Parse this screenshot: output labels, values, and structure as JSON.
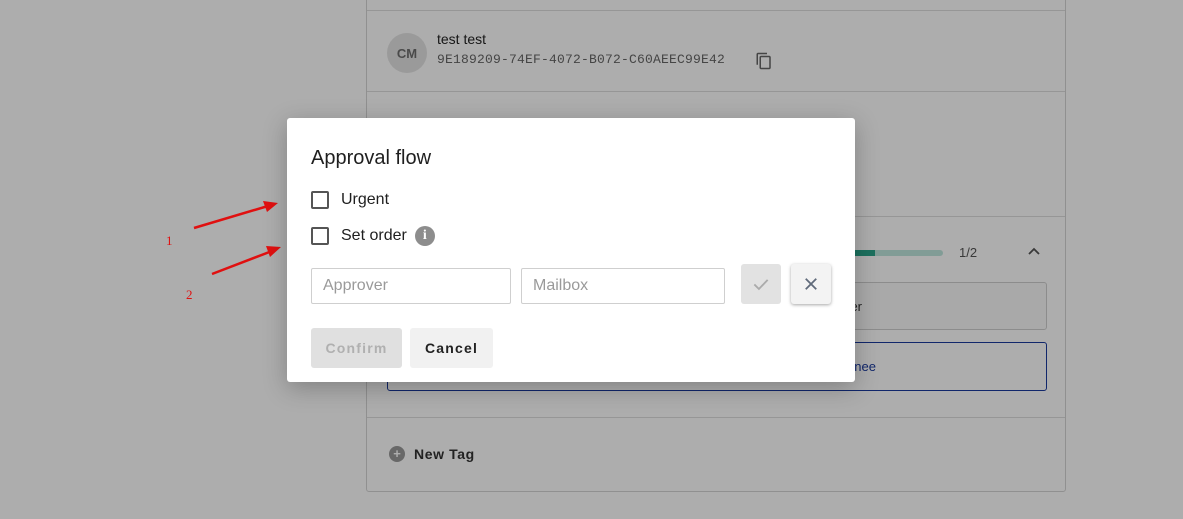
{
  "background": {
    "user": {
      "avatar_initials": "CM",
      "name": "test test",
      "id": "9E189209-74EF-4072-B072-C60AEEC99E42"
    },
    "progress": {
      "value": 0.5,
      "text": "1/2"
    },
    "button1_label_fragment": "er",
    "button2_label_fragment": "nee",
    "new_tag_label": "New Tag"
  },
  "annotations": {
    "marker1": "1",
    "marker2": "2"
  },
  "dialog": {
    "title": "Approval flow",
    "urgent_label": "Urgent",
    "set_order_label": "Set order",
    "info_glyph": "i",
    "approver_placeholder": "Approver",
    "mailbox_placeholder": "Mailbox",
    "confirm_label": "Confirm",
    "cancel_label": "Cancel",
    "icons": {
      "approve": "check-icon",
      "remove": "close-icon",
      "info": "info-icon"
    }
  },
  "colors": {
    "progress_fill": "#2aa58b",
    "annotation": "#e01010",
    "outline_button": "#1a3a9e"
  }
}
